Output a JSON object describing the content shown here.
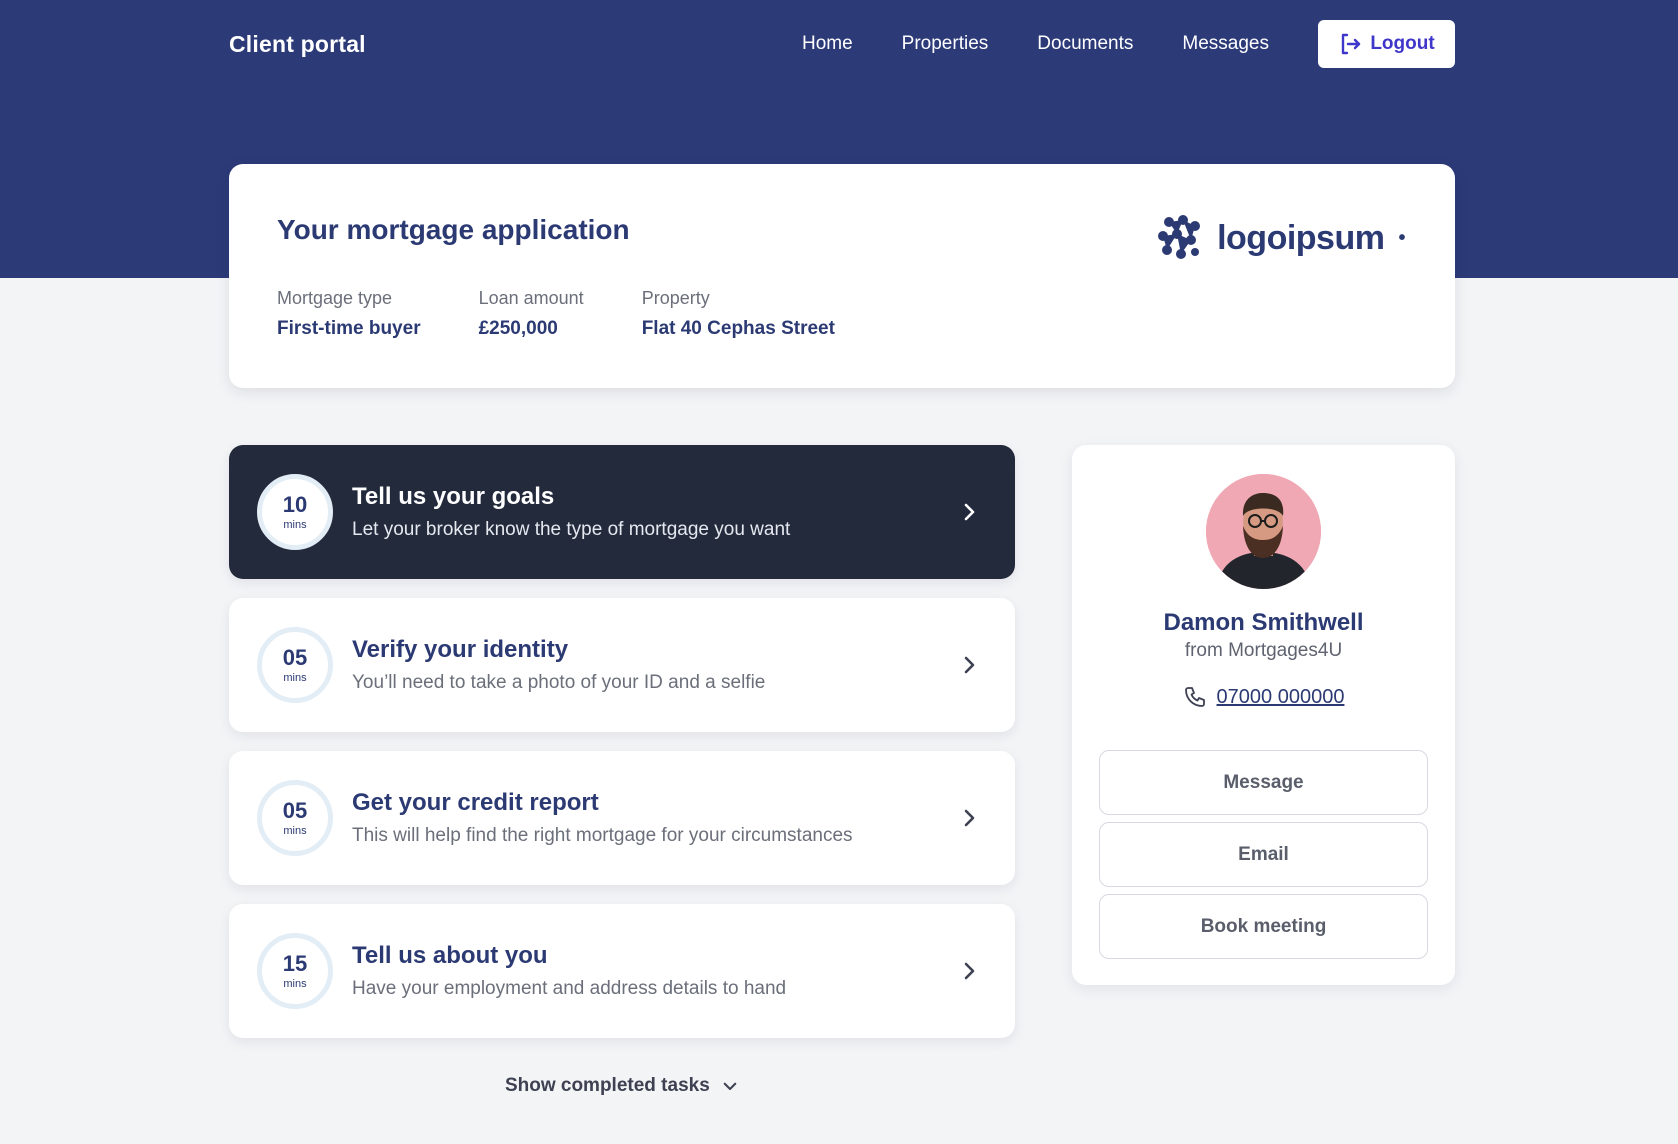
{
  "header": {
    "brand": "Client portal",
    "nav": [
      "Home",
      "Properties",
      "Documents",
      "Messages"
    ],
    "logout_label": "Logout"
  },
  "application": {
    "title": "Your mortgage application",
    "logo_text": "logoipsum",
    "meta": [
      {
        "label": "Mortgage type",
        "value": "First-time buyer"
      },
      {
        "label": "Loan amount",
        "value": "£250,000"
      },
      {
        "label": "Property",
        "value": "Flat 40 Cephas Street"
      }
    ]
  },
  "tasks": [
    {
      "time": "10",
      "unit": "mins",
      "title": "Tell us your goals",
      "desc": "Let your broker know the type of mortgage you want",
      "active": true
    },
    {
      "time": "05",
      "unit": "mins",
      "title": "Verify your identity",
      "desc": "You’ll need to take a photo of your ID and a selfie",
      "active": false
    },
    {
      "time": "05",
      "unit": "mins",
      "title": "Get your credit report",
      "desc": "This will help find the right mortgage for your circumstances",
      "active": false
    },
    {
      "time": "15",
      "unit": "mins",
      "title": "Tell us about you",
      "desc": "Have your employment and address details to hand",
      "active": false
    }
  ],
  "show_completed_label": "Show completed tasks",
  "broker": {
    "name": "Damon Smithwell",
    "company": "from Mortgages4U",
    "phone": "07000 000000",
    "buttons": [
      "Message",
      "Email",
      "Book meeting"
    ]
  },
  "colors": {
    "hero": "#2c3a78",
    "active_task": "#222a3c",
    "accent": "#3f37c9"
  }
}
